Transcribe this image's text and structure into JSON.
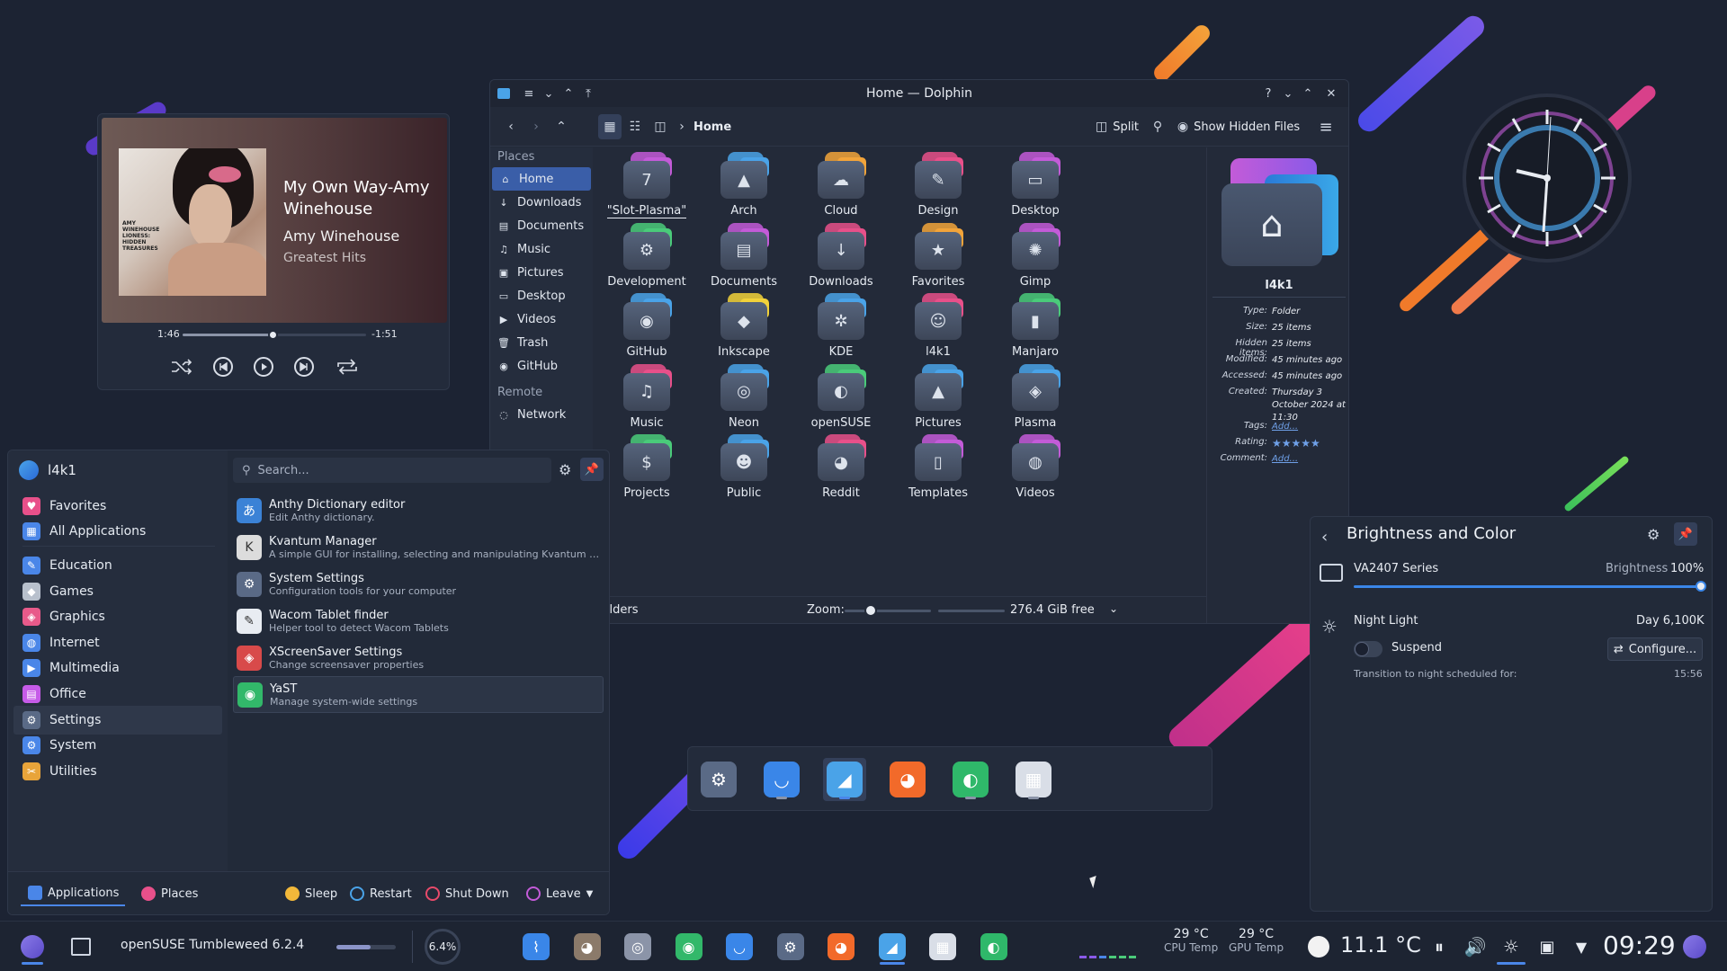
{
  "media_player": {
    "track_title": "My Own Way-Amy Winehouse",
    "artist": "Amy Winehouse",
    "album": "Greatest Hits",
    "album_art_caption": "AMY WINEHOUSE LIONESS: HIDDEN TREASURES",
    "time_elapsed": "1:46",
    "time_remaining": "-1:51",
    "progress_fraction": 0.49,
    "controls": [
      "shuffle-icon",
      "previous-icon",
      "play-icon",
      "next-icon",
      "repeat-icon"
    ]
  },
  "dolphin": {
    "title": "Home — Dolphin",
    "location": "Home",
    "split_label": "Split",
    "hidden_files_label": "Show Hidden Files",
    "places_header": "Places",
    "remote_header": "Remote",
    "places": [
      {
        "label": "Home",
        "icon": "home-icon"
      },
      {
        "label": "Downloads",
        "icon": "download-icon"
      },
      {
        "label": "Documents",
        "icon": "document-icon"
      },
      {
        "label": "Music",
        "icon": "music-icon"
      },
      {
        "label": "Pictures",
        "icon": "picture-icon"
      },
      {
        "label": "Desktop",
        "icon": "desktop-icon"
      },
      {
        "label": "Videos",
        "icon": "video-icon"
      },
      {
        "label": "Trash",
        "icon": "trash-icon"
      },
      {
        "label": "GitHub",
        "icon": "github-icon"
      }
    ],
    "remote": [
      {
        "label": "Network",
        "icon": "network-icon"
      }
    ],
    "files": [
      {
        "label": "\"Slot-Plasma\"",
        "glyph": "7",
        "tab_color": "#c35bd8"
      },
      {
        "label": "Arch",
        "glyph": "▲",
        "tab_color": "#4aa3e8"
      },
      {
        "label": "Cloud",
        "glyph": "☁",
        "tab_color": "#f2a43a"
      },
      {
        "label": "Design",
        "glyph": "✎",
        "tab_color": "#e8508a"
      },
      {
        "label": "Desktop",
        "glyph": "▭",
        "tab_color": "#c35bd8"
      },
      {
        "label": "Development",
        "glyph": "⚙",
        "tab_color": "#4acb7a"
      },
      {
        "label": "Documents",
        "glyph": "▤",
        "tab_color": "#c35bd8"
      },
      {
        "label": "Downloads",
        "glyph": "↓",
        "tab_color": "#e8508a"
      },
      {
        "label": "Favorites",
        "glyph": "★",
        "tab_color": "#f2a43a"
      },
      {
        "label": "Gimp",
        "glyph": "✺",
        "tab_color": "#c35bd8"
      },
      {
        "label": "GitHub",
        "glyph": "◉",
        "tab_color": "#4aa3e8"
      },
      {
        "label": "Inkscape",
        "glyph": "◆",
        "tab_color": "#f2d23a"
      },
      {
        "label": "KDE",
        "glyph": "✲",
        "tab_color": "#4aa3e8"
      },
      {
        "label": "l4k1",
        "glyph": "☺",
        "tab_color": "#e8508a"
      },
      {
        "label": "Manjaro",
        "glyph": "▮",
        "tab_color": "#4acb7a"
      },
      {
        "label": "Music",
        "glyph": "♫",
        "tab_color": "#e8508a"
      },
      {
        "label": "Neon",
        "glyph": "◎",
        "tab_color": "#4aa3e8"
      },
      {
        "label": "openSUSE",
        "glyph": "◐",
        "tab_color": "#4acb7a"
      },
      {
        "label": "Pictures",
        "glyph": "▲",
        "tab_color": "#4aa3e8"
      },
      {
        "label": "Plasma",
        "glyph": "◈",
        "tab_color": "#4aa3e8"
      },
      {
        "label": "Projects",
        "glyph": "$",
        "tab_color": "#4acb7a"
      },
      {
        "label": "Public",
        "glyph": "☻",
        "tab_color": "#4aa3e8"
      },
      {
        "label": "Reddit",
        "glyph": "◕",
        "tab_color": "#e8508a"
      },
      {
        "label": "Templates",
        "glyph": "▯",
        "tab_color": "#c35bd8"
      },
      {
        "label": "Videos",
        "glyph": "◍",
        "tab_color": "#c35bd8"
      }
    ],
    "status_left": "folders",
    "zoom_label": "Zoom:",
    "free_space": "276.4 GiB free",
    "info": {
      "name": "l4k1",
      "rows": [
        {
          "key": "Type:",
          "value": "Folder"
        },
        {
          "key": "Size:",
          "value": "25 items"
        },
        {
          "key": "Hidden items:",
          "value": "25 items"
        },
        {
          "key": "Modified:",
          "value": "45 minutes ago"
        },
        {
          "key": "Accessed:",
          "value": "45 minutes ago"
        },
        {
          "key": "Created:",
          "value": "Thursday 3 October 2024 at 11:30"
        },
        {
          "key": "Tags:",
          "value": "Add..."
        },
        {
          "key": "Rating:",
          "value": ""
        },
        {
          "key": "Comment:",
          "value": "Add..."
        }
      ]
    }
  },
  "launcher": {
    "user": "l4k1",
    "search_placeholder": "Search...",
    "categories": [
      {
        "label": "Favorites",
        "icon": "favorites-icon",
        "color": "#e8508a"
      },
      {
        "label": "All Applications",
        "icon": "all-apps-icon",
        "color": "#4a86e8"
      },
      {
        "label": "Education",
        "icon": "education-icon",
        "color": "#4a86e8"
      },
      {
        "label": "Games",
        "icon": "games-icon",
        "color": "#b8c0cc"
      },
      {
        "label": "Graphics",
        "icon": "graphics-icon",
        "color": "#e85a8a"
      },
      {
        "label": "Internet",
        "icon": "internet-icon",
        "color": "#4a86e8"
      },
      {
        "label": "Multimedia",
        "icon": "multimedia-icon",
        "color": "#4a86e8"
      },
      {
        "label": "Office",
        "icon": "office-icon",
        "color": "#c65be8"
      },
      {
        "label": "Settings",
        "icon": "settings-icon",
        "color": "#5a6a86"
      },
      {
        "label": "System",
        "icon": "system-icon",
        "color": "#4a86e8"
      },
      {
        "label": "Utilities",
        "icon": "utilities-icon",
        "color": "#e8a43a"
      }
    ],
    "apps": [
      {
        "name": "Anthy Dictionary editor",
        "desc": "Edit Anthy dictionary.",
        "icon": "anthy-icon",
        "color": "#3b82d6"
      },
      {
        "name": "Kvantum Manager",
        "desc": "A simple GUI for installing, selecting and manipulating Kvantum th...",
        "icon": "kvantum-icon",
        "color": "#dcdcdc"
      },
      {
        "name": "System Settings",
        "desc": "Configuration tools for your computer",
        "icon": "settings-icon",
        "color": "#5a6a86"
      },
      {
        "name": "Wacom Tablet finder",
        "desc": "Helper tool to detect Wacom Tablets",
        "icon": "wacom-icon",
        "color": "#e8ecf2"
      },
      {
        "name": "XScreenSaver Settings",
        "desc": "Change screensaver properties",
        "icon": "xscreensaver-icon",
        "color": "#d84a4a"
      },
      {
        "name": "YaST",
        "desc": "Manage system-wide settings",
        "icon": "yast-icon",
        "color": "#32b86a"
      }
    ],
    "footer": {
      "applications": "Applications",
      "places": "Places",
      "sleep": "Sleep",
      "restart": "Restart",
      "shutdown": "Shut Down",
      "leave": "Leave"
    }
  },
  "brightness_panel": {
    "title": "Brightness and Color",
    "monitor_name": "VA2407 Series",
    "brightness_label": "Brightness",
    "brightness_value": "100%",
    "brightness_fraction": 1.0,
    "night_light_label": "Night Light",
    "night_light_status": "Day 6,100K",
    "suspend_label": "Suspend",
    "configure_label": "Configure...",
    "transition_label": "Transition to night scheduled for:",
    "transition_time": "15:56"
  },
  "dock": {
    "items": [
      {
        "name": "system-settings-icon",
        "color": "#5a6a86",
        "running": false
      },
      {
        "name": "discover-icon",
        "color": "#3a86e8",
        "running": true
      },
      {
        "name": "dolphin-icon",
        "color": "#4aa3e8",
        "running": true,
        "focused": true
      },
      {
        "name": "firefox-icon",
        "color": "#f26a2a",
        "running": false
      },
      {
        "name": "krita-icon",
        "color": "#2fb86a",
        "running": true
      },
      {
        "name": "calculator-icon",
        "color": "#d9dee7",
        "running": true
      }
    ]
  },
  "taskbar": {
    "os_label": "openSUSE Tumbleweed 6.2.4",
    "cpu_percent": "6.4%",
    "cpu_temp": "29 °C",
    "cpu_temp_label": "CPU Temp",
    "gpu_temp": "29 °C",
    "gpu_temp_label": "GPU Temp",
    "weather": "11.1 °C",
    "time": "09:29",
    "apps": [
      {
        "name": "system-monitor-icon",
        "color": "#3a86e8"
      },
      {
        "name": "gimp-icon",
        "color": "#8b7a6a"
      },
      {
        "name": "steam-icon",
        "color": "#8b94a8"
      },
      {
        "name": "yast-icon",
        "color": "#32b86a"
      },
      {
        "name": "discover-icon",
        "color": "#3a86e8"
      },
      {
        "name": "system-settings-icon",
        "color": "#5a6a86"
      },
      {
        "name": "firefox-icon",
        "color": "#f26a2a"
      },
      {
        "name": "dolphin-icon",
        "color": "#4aa3e8"
      },
      {
        "name": "calculator-icon",
        "color": "#d9dee7"
      },
      {
        "name": "krita-icon",
        "color": "#2fb86a"
      }
    ]
  }
}
